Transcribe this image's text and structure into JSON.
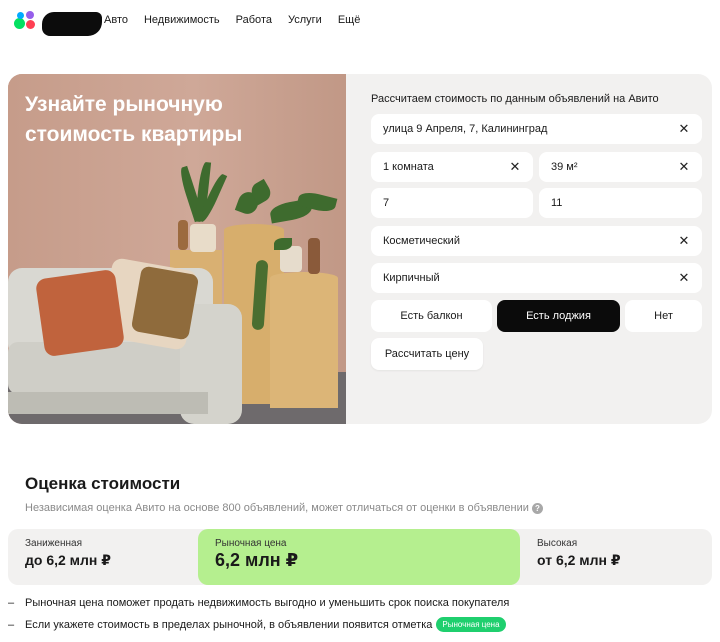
{
  "nav": {
    "logo_icon": "avito-logo",
    "links": [
      "Авто",
      "Недвижимость",
      "Работа",
      "Услуги",
      "Ещё"
    ]
  },
  "hero": {
    "title": "Узнайте рыночную стоимость квартиры"
  },
  "form": {
    "heading": "Рассчитаем стоимость по данным объявлений на Авито",
    "address": "улица 9 Апреля, 7, Калининград",
    "rooms": "1 комната",
    "area": "39 м²",
    "floor": "7",
    "floors_total": "11",
    "renovation": "Косметический",
    "building_type": "Кирпичный",
    "balcony_options": [
      "Есть балкон",
      "Есть лоджия",
      "Нет"
    ],
    "balcony_selected": "Есть лоджия",
    "calc_button": "Рассчитать цену",
    "clear_icon": "close-icon"
  },
  "estimate": {
    "title": "Оценка стоимости",
    "subtitle": "Независимая оценка Авито на основе 800 объявлений, может отличаться от оценки в объявлении",
    "low_label": "Заниженная",
    "low_value": "до 6,2 млн ₽",
    "market_label": "Рыночная цена",
    "market_value": "6,2 млн ₽",
    "high_label": "Высокая",
    "high_value": "от 6,2 млн ₽",
    "market_color": "#b5ef8f"
  },
  "notes": {
    "note1": "Рыночная цена поможет продать недвижимость выгодно и уменьшить срок поиска покупателя",
    "note2": "Если укажете стоимость в пределах рыночной, в объявлении появится отметка",
    "badge": "Рыночная цена"
  }
}
